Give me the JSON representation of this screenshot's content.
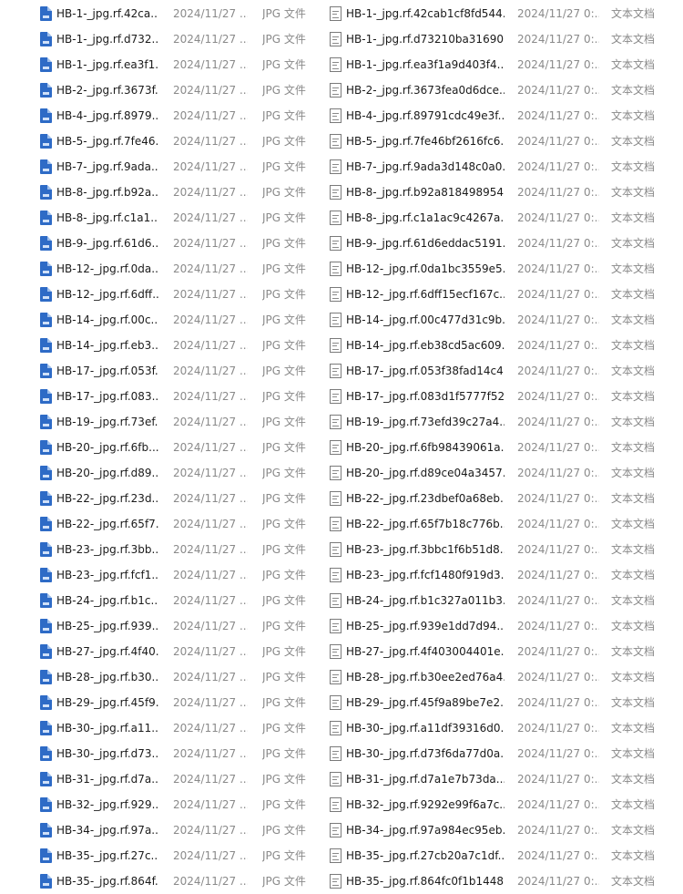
{
  "list": {
    "left_type": "JPG 文件",
    "right_type": "文本文档",
    "left_date": "2024/11/27 ...",
    "right_date": "2024/11/27 0:...",
    "rows": [
      {
        "jpg_name": "HB-1-_jpg.rf.42ca...",
        "txt_name": "HB-1-_jpg.rf.42cab1cf8fd544..."
      },
      {
        "jpg_name": "HB-1-_jpg.rf.d732...",
        "txt_name": "HB-1-_jpg.rf.d73210ba31690..."
      },
      {
        "jpg_name": "HB-1-_jpg.rf.ea3f1...",
        "txt_name": "HB-1-_jpg.rf.ea3f1a9d403f4..."
      },
      {
        "jpg_name": "HB-2-_jpg.rf.3673f...",
        "txt_name": "HB-2-_jpg.rf.3673fea0d6dce..."
      },
      {
        "jpg_name": "HB-4-_jpg.rf.8979...",
        "txt_name": "HB-4-_jpg.rf.89791cdc49e3f..."
      },
      {
        "jpg_name": "HB-5-_jpg.rf.7fe46...",
        "txt_name": "HB-5-_jpg.rf.7fe46bf2616fc6..."
      },
      {
        "jpg_name": "HB-7-_jpg.rf.9ada...",
        "txt_name": "HB-7-_jpg.rf.9ada3d148c0a0..."
      },
      {
        "jpg_name": "HB-8-_jpg.rf.b92a...",
        "txt_name": "HB-8-_jpg.rf.b92a818498954..."
      },
      {
        "jpg_name": "HB-8-_jpg.rf.c1a1...",
        "txt_name": "HB-8-_jpg.rf.c1a1ac9c4267a..."
      },
      {
        "jpg_name": "HB-9-_jpg.rf.61d6...",
        "txt_name": "HB-9-_jpg.rf.61d6eddac5191..."
      },
      {
        "jpg_name": "HB-12-_jpg.rf.0da...",
        "txt_name": "HB-12-_jpg.rf.0da1bc3559e5..."
      },
      {
        "jpg_name": "HB-12-_jpg.rf.6dff...",
        "txt_name": "HB-12-_jpg.rf.6dff15ecf167c..."
      },
      {
        "jpg_name": "HB-14-_jpg.rf.00c...",
        "txt_name": "HB-14-_jpg.rf.00c477d31c9b..."
      },
      {
        "jpg_name": "HB-14-_jpg.rf.eb3...",
        "txt_name": "HB-14-_jpg.rf.eb38cd5ac609..."
      },
      {
        "jpg_name": "HB-17-_jpg.rf.053f...",
        "txt_name": "HB-17-_jpg.rf.053f38fad14c4..."
      },
      {
        "jpg_name": "HB-17-_jpg.rf.083...",
        "txt_name": "HB-17-_jpg.rf.083d1f5777f52..."
      },
      {
        "jpg_name": "HB-19-_jpg.rf.73ef...",
        "txt_name": "HB-19-_jpg.rf.73efd39c27a4..."
      },
      {
        "jpg_name": "HB-20-_jpg.rf.6fb...",
        "txt_name": "HB-20-_jpg.rf.6fb98439061a..."
      },
      {
        "jpg_name": "HB-20-_jpg.rf.d89...",
        "txt_name": "HB-20-_jpg.rf.d89ce04a3457..."
      },
      {
        "jpg_name": "HB-22-_jpg.rf.23d...",
        "txt_name": "HB-22-_jpg.rf.23dbef0a68eb..."
      },
      {
        "jpg_name": "HB-22-_jpg.rf.65f7...",
        "txt_name": "HB-22-_jpg.rf.65f7b18c776b..."
      },
      {
        "jpg_name": "HB-23-_jpg.rf.3bb...",
        "txt_name": "HB-23-_jpg.rf.3bbc1f6b51d8..."
      },
      {
        "jpg_name": "HB-23-_jpg.rf.fcf1...",
        "txt_name": "HB-23-_jpg.rf.fcf1480f919d3..."
      },
      {
        "jpg_name": "HB-24-_jpg.rf.b1c...",
        "txt_name": "HB-24-_jpg.rf.b1c327a011b3..."
      },
      {
        "jpg_name": "HB-25-_jpg.rf.939...",
        "txt_name": "HB-25-_jpg.rf.939e1dd7d94..."
      },
      {
        "jpg_name": "HB-27-_jpg.rf.4f40...",
        "txt_name": "HB-27-_jpg.rf.4f403004401e..."
      },
      {
        "jpg_name": "HB-28-_jpg.rf.b30...",
        "txt_name": "HB-28-_jpg.rf.b30ee2ed76a4..."
      },
      {
        "jpg_name": "HB-29-_jpg.rf.45f9...",
        "txt_name": "HB-29-_jpg.rf.45f9a89be7e2..."
      },
      {
        "jpg_name": "HB-30-_jpg.rf.a11...",
        "txt_name": "HB-30-_jpg.rf.a11df39316d0..."
      },
      {
        "jpg_name": "HB-30-_jpg.rf.d73...",
        "txt_name": "HB-30-_jpg.rf.d73f6da77d0a..."
      },
      {
        "jpg_name": "HB-31-_jpg.rf.d7a...",
        "txt_name": "HB-31-_jpg.rf.d7a1e7b73da..."
      },
      {
        "jpg_name": "HB-32-_jpg.rf.929...",
        "txt_name": "HB-32-_jpg.rf.9292e99f6a7c..."
      },
      {
        "jpg_name": "HB-34-_jpg.rf.97a...",
        "txt_name": "HB-34-_jpg.rf.97a984ec95eb..."
      },
      {
        "jpg_name": "HB-35-_jpg.rf.27c...",
        "txt_name": "HB-35-_jpg.rf.27cb20a7c1df..."
      },
      {
        "jpg_name": "HB-35-_jpg.rf.864f...",
        "txt_name": "HB-35-_jpg.rf.864fc0f1b1448..."
      }
    ]
  }
}
